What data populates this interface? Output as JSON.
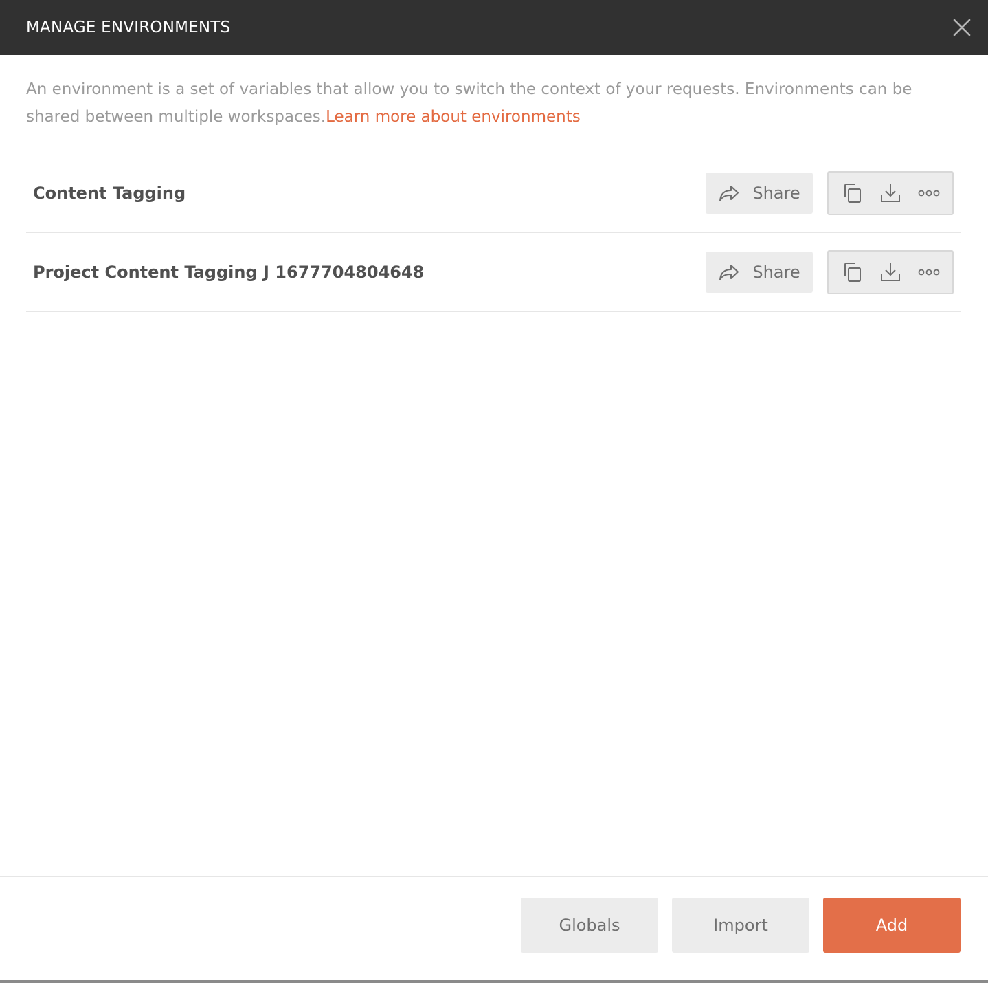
{
  "header": {
    "title": "MANAGE ENVIRONMENTS",
    "close_icon": "close-icon"
  },
  "description": {
    "text": "An environment is a set of variables that allow you to switch the context of your requests. Environments can be shared between multiple workspaces.",
    "link_text": "Learn more about environments",
    "link_color": "#e36a41"
  },
  "environments": [
    {
      "name": "Content Tagging",
      "share_label": "Share",
      "icons": [
        "share-icon",
        "duplicate-icon",
        "download-icon",
        "more-icon"
      ]
    },
    {
      "name": "Project Content Tagging J 1677704804648",
      "share_label": "Share",
      "icons": [
        "share-icon",
        "duplicate-icon",
        "download-icon",
        "more-icon"
      ]
    }
  ],
  "footer": {
    "globals_label": "Globals",
    "import_label": "Import",
    "add_label": "Add",
    "accent_color": "#e36f49"
  }
}
